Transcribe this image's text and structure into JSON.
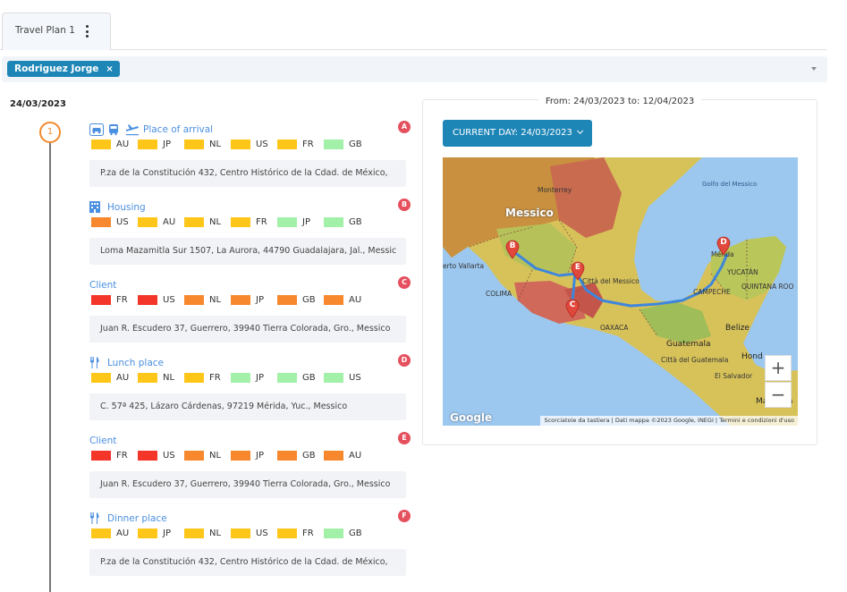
{
  "tab": {
    "label": "Travel Plan 1"
  },
  "user_chip": {
    "name": "Rodriguez Jorge",
    "remove": "×"
  },
  "day": {
    "date": "24/03/2023",
    "number": "1"
  },
  "colors": {
    "AU": "#ffc61a",
    "JP": "#ffc61a",
    "NL": "#ffc61a",
    "US": "#ffc61a",
    "FR": "#ffc61a",
    "GB": "#a3f0a8",
    "orange": "#f7882e",
    "red": "#f4352a",
    "green": "#a3f0a8",
    "yellow": "#ffc61a"
  },
  "stops": [
    {
      "title": "Place of arrival",
      "icons": [
        "car-icon",
        "bus-icon",
        "plane-icon"
      ],
      "marker": "A",
      "flags": [
        {
          "cc": "AU",
          "color": "#ffc61a"
        },
        {
          "cc": "JP",
          "color": "#ffc61a"
        },
        {
          "cc": "NL",
          "color": "#ffc61a"
        },
        {
          "cc": "US",
          "color": "#ffc61a"
        },
        {
          "cc": "FR",
          "color": "#ffc61a"
        },
        {
          "cc": "GB",
          "color": "#a3f0a8"
        }
      ],
      "address": "P.za de la Constitución 432, Centro Histórico de la Cdad. de México,"
    },
    {
      "title": "Housing",
      "icons": [
        "building-icon"
      ],
      "marker": "B",
      "flags": [
        {
          "cc": "US",
          "color": "#f7882e"
        },
        {
          "cc": "AU",
          "color": "#ffc61a"
        },
        {
          "cc": "NL",
          "color": "#ffc61a"
        },
        {
          "cc": "FR",
          "color": "#ffc61a"
        },
        {
          "cc": "JP",
          "color": "#a3f0a8"
        },
        {
          "cc": "GB",
          "color": "#a3f0a8"
        }
      ],
      "address": "Loma Mazamitla Sur 1507, La Aurora, 44790 Guadalajara, Jal., Messic"
    },
    {
      "title": "Client",
      "icons": [],
      "marker": "C",
      "flags": [
        {
          "cc": "FR",
          "color": "#f4352a"
        },
        {
          "cc": "US",
          "color": "#f4352a"
        },
        {
          "cc": "NL",
          "color": "#f7882e"
        },
        {
          "cc": "JP",
          "color": "#f7882e"
        },
        {
          "cc": "GB",
          "color": "#f7882e"
        },
        {
          "cc": "AU",
          "color": "#f7882e"
        }
      ],
      "address": "Juan R. Escudero 37, Guerrero, 39940 Tierra Colorada, Gro., Messico"
    },
    {
      "title": "Lunch place",
      "icons": [
        "cutlery-icon"
      ],
      "marker": "D",
      "flags": [
        {
          "cc": "AU",
          "color": "#ffc61a"
        },
        {
          "cc": "NL",
          "color": "#ffc61a"
        },
        {
          "cc": "FR",
          "color": "#ffc61a"
        },
        {
          "cc": "JP",
          "color": "#a3f0a8"
        },
        {
          "cc": "GB",
          "color": "#a3f0a8"
        },
        {
          "cc": "US",
          "color": "#a3f0a8"
        }
      ],
      "address": "C. 57ª 425, Lázaro Cárdenas, 97219 Mérida, Yuc., Messico"
    },
    {
      "title": "Client",
      "icons": [],
      "marker": "E",
      "flags": [
        {
          "cc": "FR",
          "color": "#f4352a"
        },
        {
          "cc": "US",
          "color": "#f4352a"
        },
        {
          "cc": "NL",
          "color": "#f7882e"
        },
        {
          "cc": "JP",
          "color": "#f7882e"
        },
        {
          "cc": "GB",
          "color": "#f7882e"
        },
        {
          "cc": "AU",
          "color": "#f7882e"
        }
      ],
      "address": "Juan R. Escudero 37, Guerrero, 39940 Tierra Colorada, Gro., Messico"
    },
    {
      "title": "Dinner place",
      "icons": [
        "cutlery-icon"
      ],
      "marker": "F",
      "flags": [
        {
          "cc": "AU",
          "color": "#ffc61a"
        },
        {
          "cc": "JP",
          "color": "#ffc61a"
        },
        {
          "cc": "NL",
          "color": "#ffc61a"
        },
        {
          "cc": "US",
          "color": "#ffc61a"
        },
        {
          "cc": "FR",
          "color": "#ffc61a"
        },
        {
          "cc": "GB",
          "color": "#a3f0a8"
        }
      ],
      "address": "P.za de la Constitución 432, Centro Histórico de la Cdad. de México,"
    }
  ],
  "panel": {
    "range": "From: 24/03/2023 to: 12/04/2023",
    "current_day": "CURRENT DAY: 24/03/2023"
  },
  "map": {
    "labels": {
      "messico": "Messico",
      "golfo": "Golfo del Messico",
      "monterrey": "Monterrey",
      "merida": "Mérida",
      "yucatan": "YUCATÁN",
      "campeche": "CAMPECHE",
      "quintana": "QUINTANA ROO",
      "belize": "Belize",
      "guatemala": "Guatemala",
      "guatemala_city": "Città del Guatemala",
      "el_salvador": "El Salvador",
      "honduras": "Hond",
      "managua": "Managua",
      "vallarta": "erto Vallarta",
      "citta_messico": "Città del Messico",
      "colima": "COLIMA",
      "oaxaca": "OAXACA"
    },
    "markers": [
      "B",
      "E",
      "C",
      "D"
    ],
    "zoom_in": "+",
    "zoom_out": "−",
    "logo": "Google",
    "attribution": "Scorciatoie da tastiera | Dati mappa ©2023 Google, INEGI | Termini e condizioni d'uso"
  }
}
